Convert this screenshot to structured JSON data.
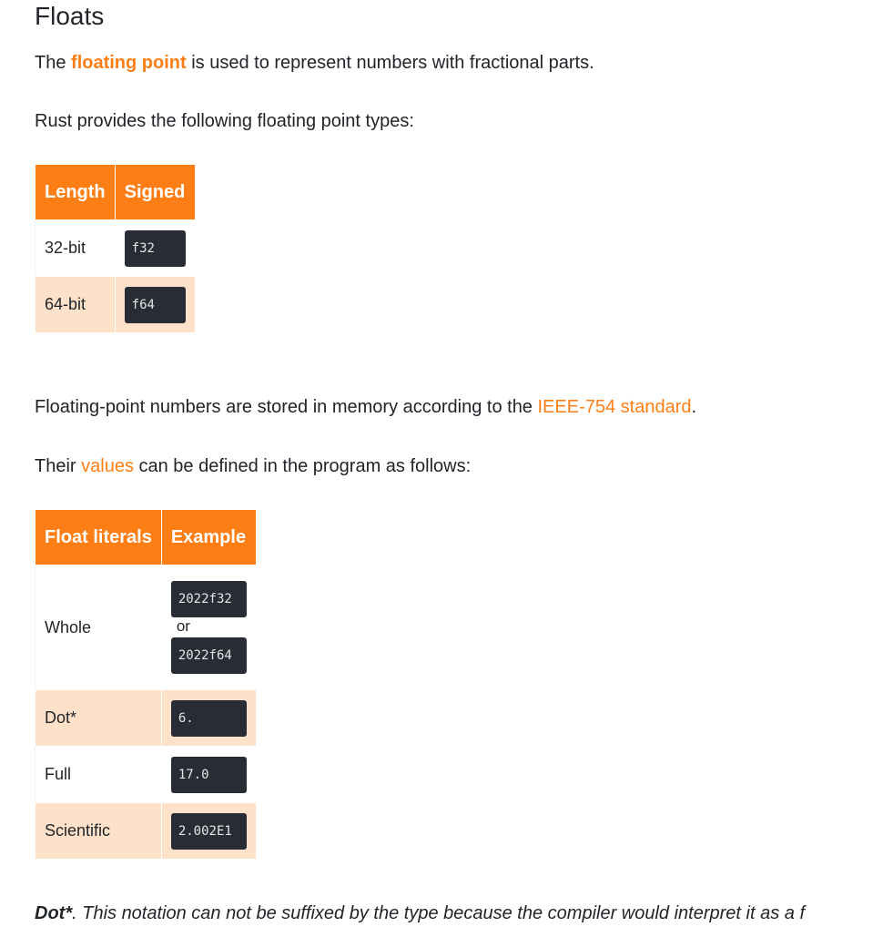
{
  "heading": "Floats",
  "intro": {
    "before": "The ",
    "highlight": "floating point",
    "after": " is used to represent numbers with fractional parts."
  },
  "types_intro": "Rust provides the following floating point types:",
  "types_table": {
    "headers": [
      "Length",
      "Signed"
    ],
    "rows": [
      {
        "length": "32-bit",
        "signed": "f32"
      },
      {
        "length": "64-bit",
        "signed": "f64"
      }
    ]
  },
  "storage_text": {
    "before": "Floating-point numbers are stored in memory according to the ",
    "link": "IEEE-754 standard",
    "after": "."
  },
  "values_text": {
    "before": "Their ",
    "link": "values",
    "after": " can be defined in the program as follows:"
  },
  "literals_table": {
    "headers": [
      "Float literals",
      "Example"
    ],
    "rows": [
      {
        "name": "Whole",
        "examples": [
          "2022f32",
          "2022f64"
        ],
        "joiner": "or"
      },
      {
        "name": "Dot*",
        "examples": [
          "6."
        ]
      },
      {
        "name": "Full",
        "examples": [
          "17.0"
        ]
      },
      {
        "name": "Scientific",
        "examples": [
          "2.002E1"
        ]
      }
    ]
  },
  "footnote": {
    "marker": "Dot*",
    "text": ". This notation can not be suffixed by the type because the compiler would interpret it as a f"
  },
  "colors": {
    "accent": "#fd7e14",
    "row_alt": "#fde2c9",
    "code_bg": "#282c34"
  }
}
